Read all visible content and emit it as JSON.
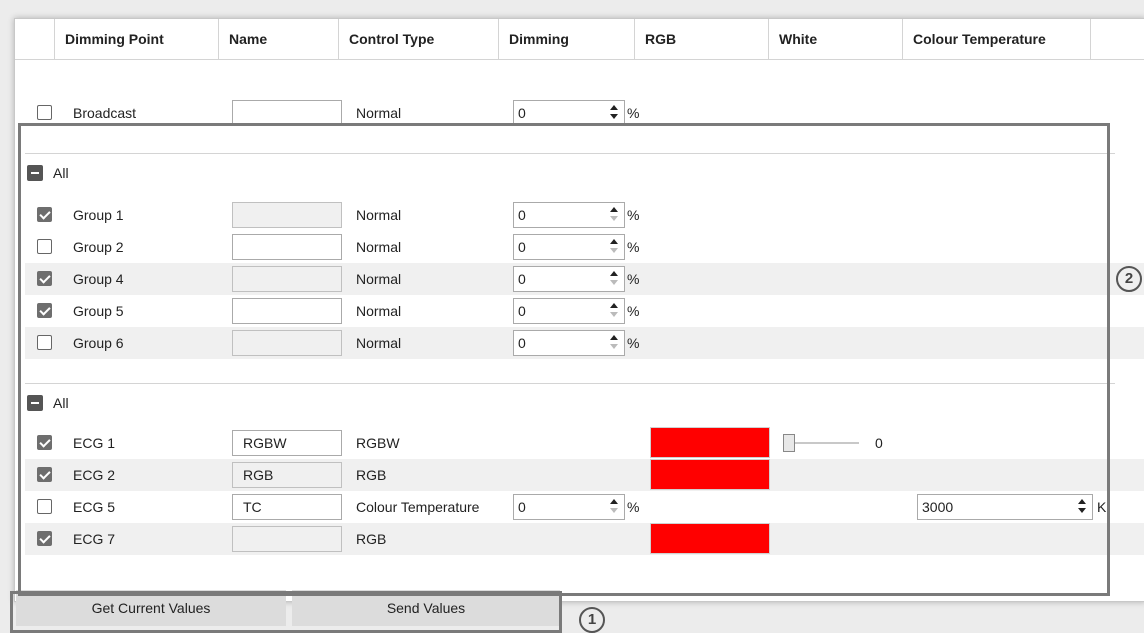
{
  "columns": {
    "dimming_point": "Dimming Point",
    "name": "Name",
    "control_type": "Control Type",
    "dimming": "Dimming",
    "rgb": "RGB",
    "white": "White",
    "colour_temperature": "Colour Temperature"
  },
  "broadcast": {
    "label": "Broadcast",
    "name": "",
    "control_type": "Normal",
    "dimming": "0",
    "unit": "%",
    "checked": false
  },
  "groups_section": {
    "label": "All"
  },
  "groups": [
    {
      "label": "Group 1",
      "name": "",
      "control_type": "Normal",
      "dimming": "0",
      "unit": "%",
      "checked": true
    },
    {
      "label": "Group 2",
      "name": "",
      "control_type": "Normal",
      "dimming": "0",
      "unit": "%",
      "checked": false
    },
    {
      "label": "Group 4",
      "name": "",
      "control_type": "Normal",
      "dimming": "0",
      "unit": "%",
      "checked": true
    },
    {
      "label": "Group 5",
      "name": "",
      "control_type": "Normal",
      "dimming": "0",
      "unit": "%",
      "checked": true
    },
    {
      "label": "Group 6",
      "name": "",
      "control_type": "Normal",
      "dimming": "0",
      "unit": "%",
      "checked": false
    }
  ],
  "ecg_section": {
    "label": "All"
  },
  "ecgs": [
    {
      "label": "ECG 1",
      "name": "RGBW",
      "control_type": "RGBW",
      "checked": true,
      "rgb_color": "#ff0000",
      "white_value": "0"
    },
    {
      "label": "ECG 2",
      "name": "RGB",
      "control_type": "RGB",
      "checked": true,
      "rgb_color": "#ff0000"
    },
    {
      "label": "ECG 5",
      "name": "TC",
      "control_type": "Colour Temperature",
      "checked": false,
      "dimming": "0",
      "unit": "%",
      "colour_temperature": "3000",
      "ct_unit": "K"
    },
    {
      "label": "ECG 7",
      "name": "",
      "control_type": "RGB",
      "checked": true,
      "rgb_color": "#ff0000"
    }
  ],
  "buttons": {
    "get_current_values": "Get Current Values",
    "send_values": "Send Values"
  },
  "callouts": {
    "one": "1",
    "two": "2"
  }
}
